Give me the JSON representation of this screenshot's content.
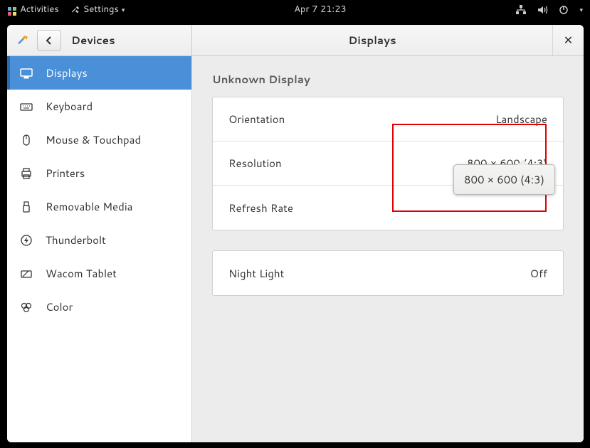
{
  "topbar": {
    "activities": "Activities",
    "settings": "Settings",
    "clock": "Apr 7  21:23"
  },
  "titlebar": {
    "devices": "Devices",
    "title": "Displays"
  },
  "sidebar": {
    "items": [
      {
        "label": "Displays"
      },
      {
        "label": "Keyboard"
      },
      {
        "label": "Mouse & Touchpad"
      },
      {
        "label": "Printers"
      },
      {
        "label": "Removable Media"
      },
      {
        "label": "Thunderbolt"
      },
      {
        "label": "Wacom Tablet"
      },
      {
        "label": "Color"
      }
    ]
  },
  "content": {
    "display_name": "Unknown Display",
    "orientation_label": "Orientation",
    "orientation_value": "Landscape",
    "resolution_label": "Resolution",
    "resolution_value": "800 × 600 (4:3)",
    "refresh_label": "Refresh Rate",
    "refresh_value": "",
    "nightlight_label": "Night Light",
    "nightlight_value": "Off",
    "dropdown_option": "800 × 600 (4:3)"
  }
}
